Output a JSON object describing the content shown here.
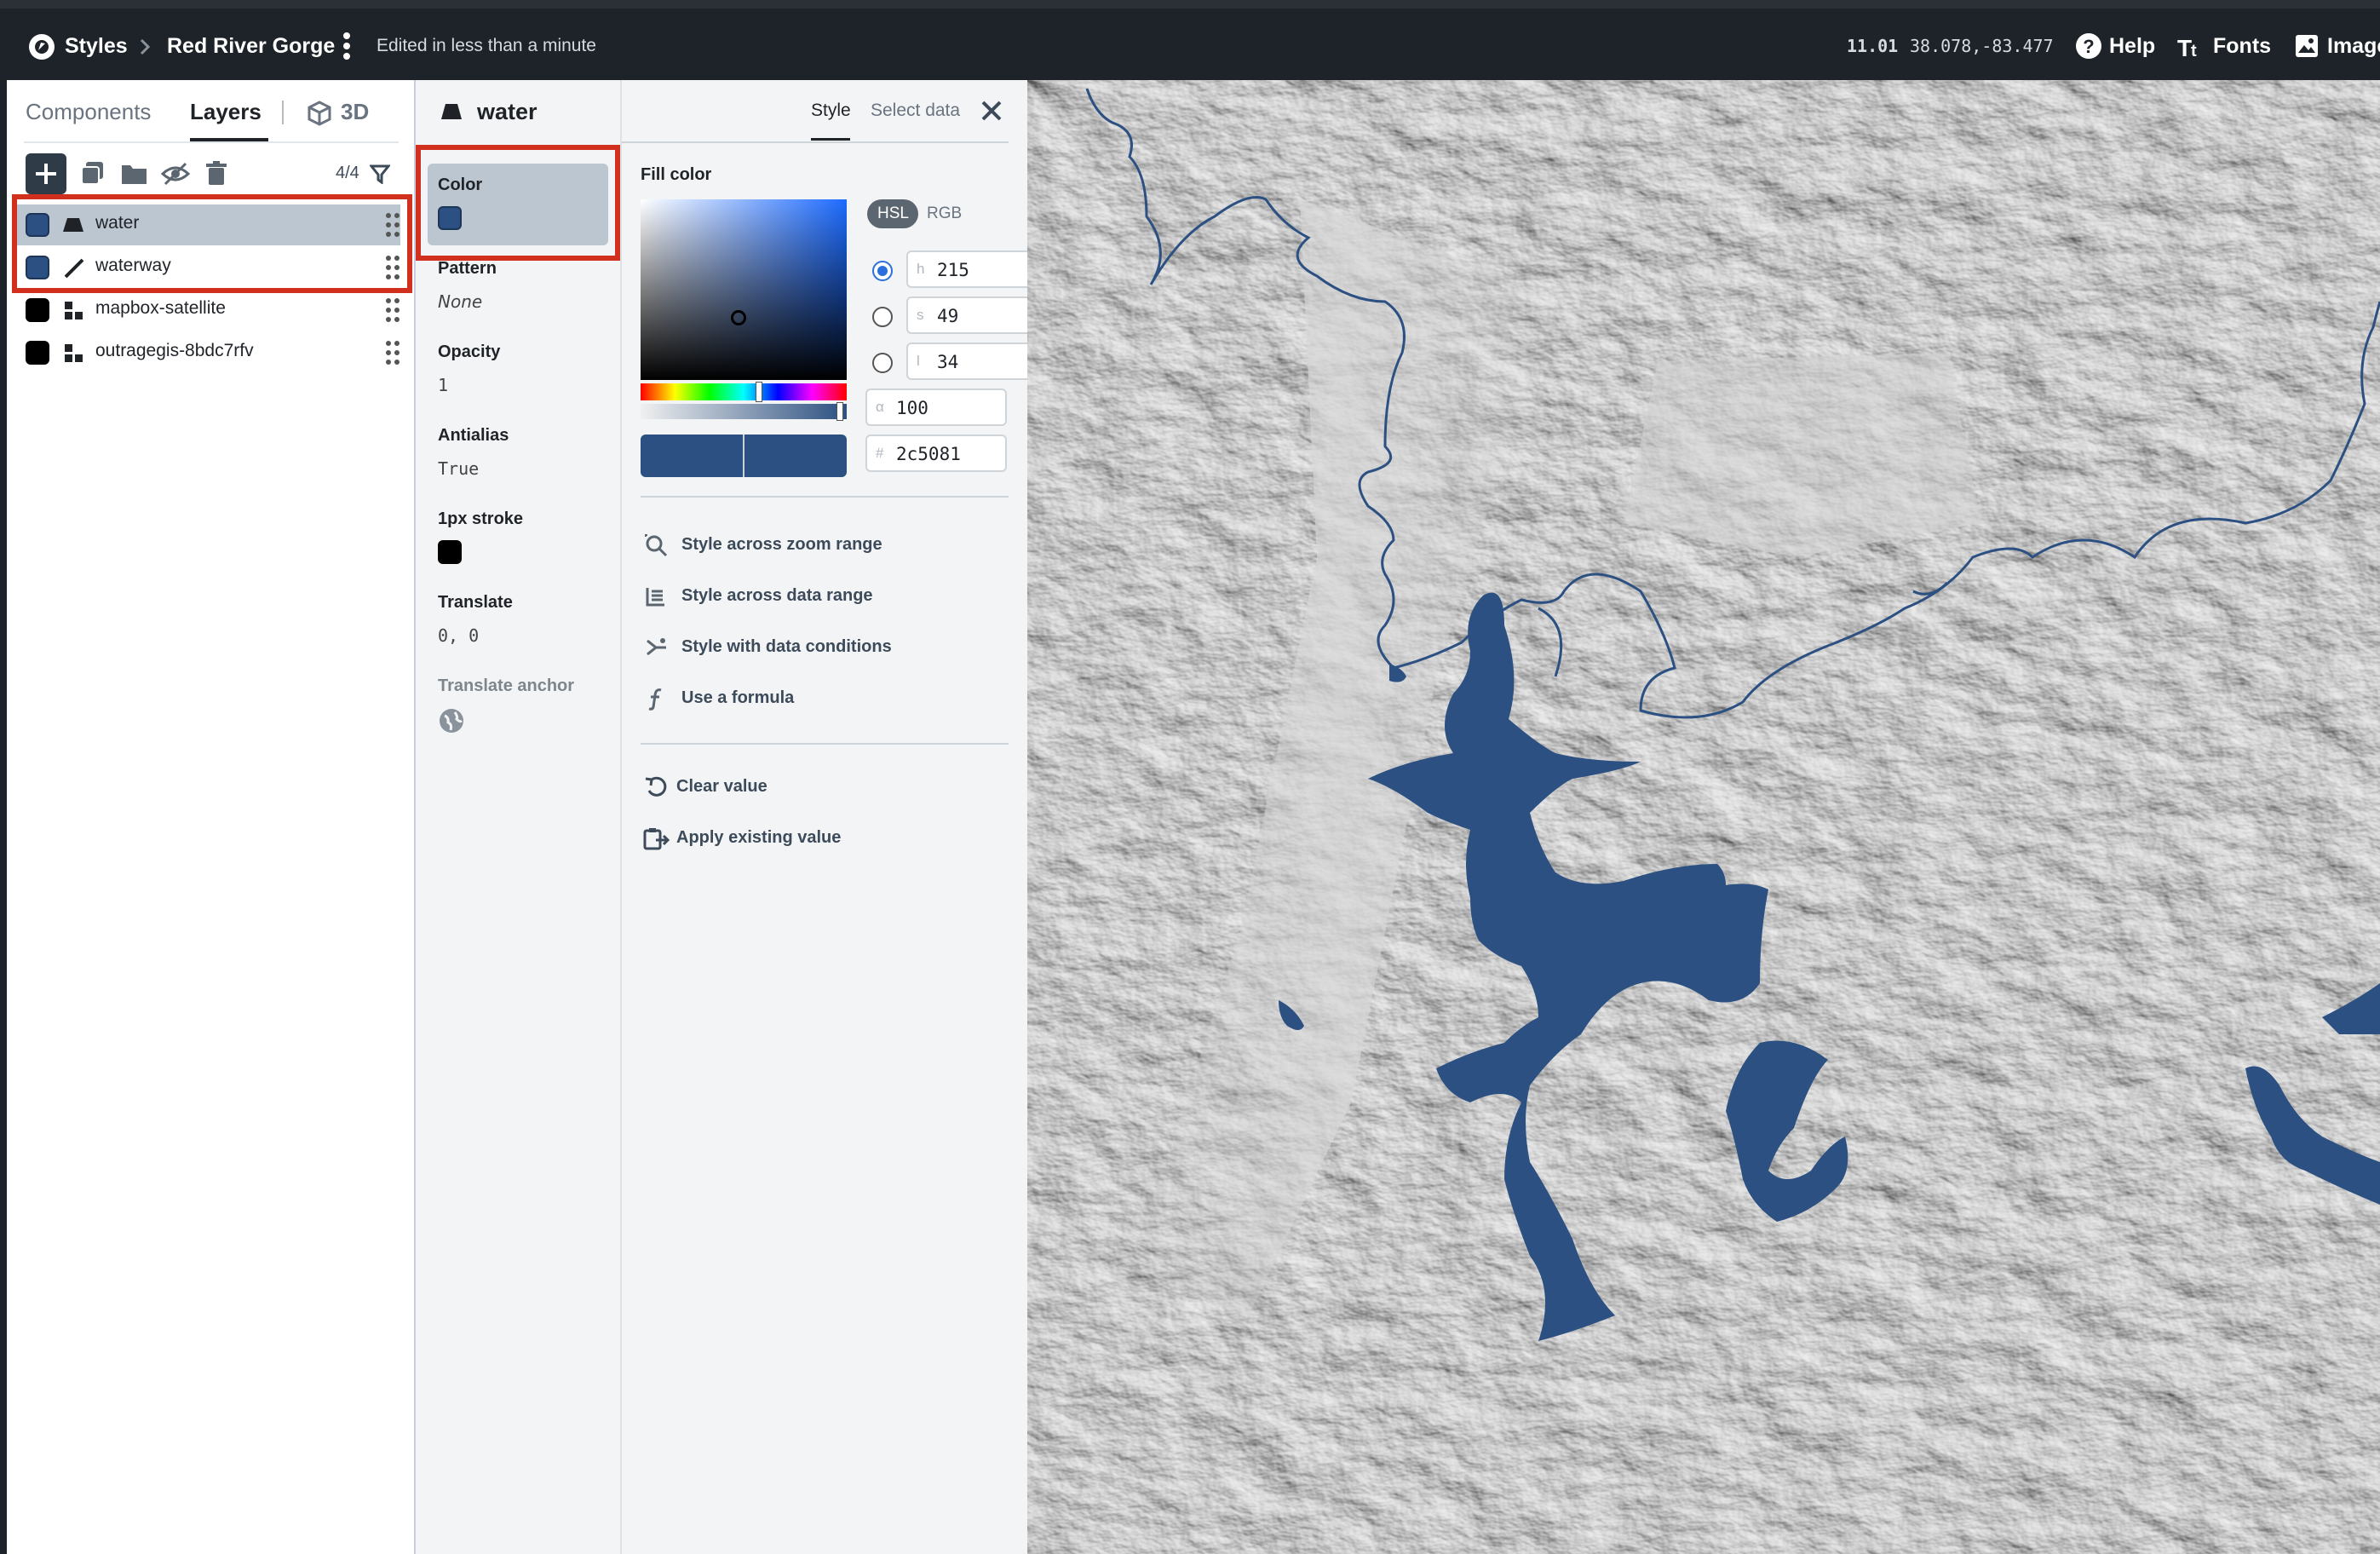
{
  "topbar": {
    "breadcrumb_root": "Styles",
    "style_name": "Red River Gorge",
    "edit_status": "Edited in less than a minute",
    "zoom": "11.01",
    "coords": "38.078,-83.477",
    "help": "Help",
    "fonts": "Fonts",
    "images": "Images"
  },
  "sidebar": {
    "tabs": [
      "Components",
      "Layers",
      "3D"
    ],
    "active_tab": "Layers",
    "layer_count": "4/4",
    "layers": [
      {
        "name": "water",
        "swatch": "#2c5081",
        "icon": "fill-icon",
        "selected": true
      },
      {
        "name": "waterway",
        "swatch": "#2c5081",
        "icon": "line-icon",
        "selected": false
      },
      {
        "name": "mapbox-satellite",
        "swatch": "#000000",
        "icon": "raster-icon",
        "selected": false
      },
      {
        "name": "outragegis-8bdc7rfv",
        "swatch": "#000000",
        "icon": "raster-icon",
        "selected": false
      }
    ]
  },
  "editor": {
    "layer_name": "water",
    "tabs": [
      "Style",
      "Select data"
    ],
    "active_tab": "Style",
    "properties": [
      {
        "label": "Color",
        "value": ""
      },
      {
        "label": "Pattern",
        "value": "None"
      },
      {
        "label": "Opacity",
        "value": "1"
      },
      {
        "label": "Antialias",
        "value": "True"
      },
      {
        "label": "1px stroke",
        "value": ""
      },
      {
        "label": "Translate",
        "value": "0, 0"
      },
      {
        "label": "Translate anchor",
        "value": ""
      }
    ],
    "fill_color_title": "Fill color",
    "modes": [
      "HSL",
      "RGB"
    ],
    "active_mode": "HSL",
    "hsl": {
      "h_prefix": "h",
      "h": "215",
      "s_prefix": "s",
      "s": "49",
      "l_prefix": "l",
      "l": "34"
    },
    "alpha_prefix": "α",
    "alpha": "100",
    "hex_prefix": "#",
    "hex": "2c5081",
    "actions": [
      "Style across zoom range",
      "Style across data range",
      "Style with data conditions",
      "Use a formula"
    ],
    "value_actions": [
      "Clear value",
      "Apply existing value"
    ]
  },
  "colors": {
    "water": "#2c5081",
    "topbar": "#1d2328",
    "highlight": "#d2301f",
    "selected_row": "#bcc6d1"
  }
}
